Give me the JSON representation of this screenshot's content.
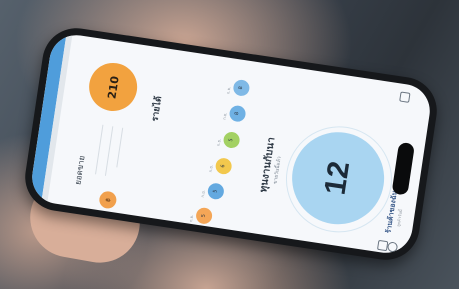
{
  "app": {
    "main_value": "12",
    "orange_value": "210",
    "left_heading": "รายได้",
    "center_heading": "ทุนงานกับนา",
    "center_sub": "ขายวันนี้แล้ว",
    "left_sub": "ยอดขาย",
    "right_label": "ร้านค้าของฉัน",
    "right_sub": "ลูกค้าวันนี้"
  },
  "bubbles": [
    {
      "value": "8",
      "label": "ก.ย.",
      "color": "#7fb9e6"
    },
    {
      "value": "8",
      "label": "ก.ย.",
      "color": "#6fb1e4"
    },
    {
      "value": "5",
      "label": "ก.ย.",
      "color": "#a3d163"
    },
    {
      "value": "6",
      "label": "ก.ย.",
      "color": "#f2c84d"
    },
    {
      "value": "5",
      "label": "ก.ย.",
      "color": "#63a9e0"
    },
    {
      "value": "5",
      "label": "ก.ย.",
      "color": "#f4a657"
    }
  ],
  "small": {
    "orange_badge": "฿",
    "extra_badge": "฿"
  },
  "colors": {
    "accent_blue": "#4f9ddb",
    "orange": "#f2a23f",
    "circle_blue": "#a9d5f1"
  }
}
